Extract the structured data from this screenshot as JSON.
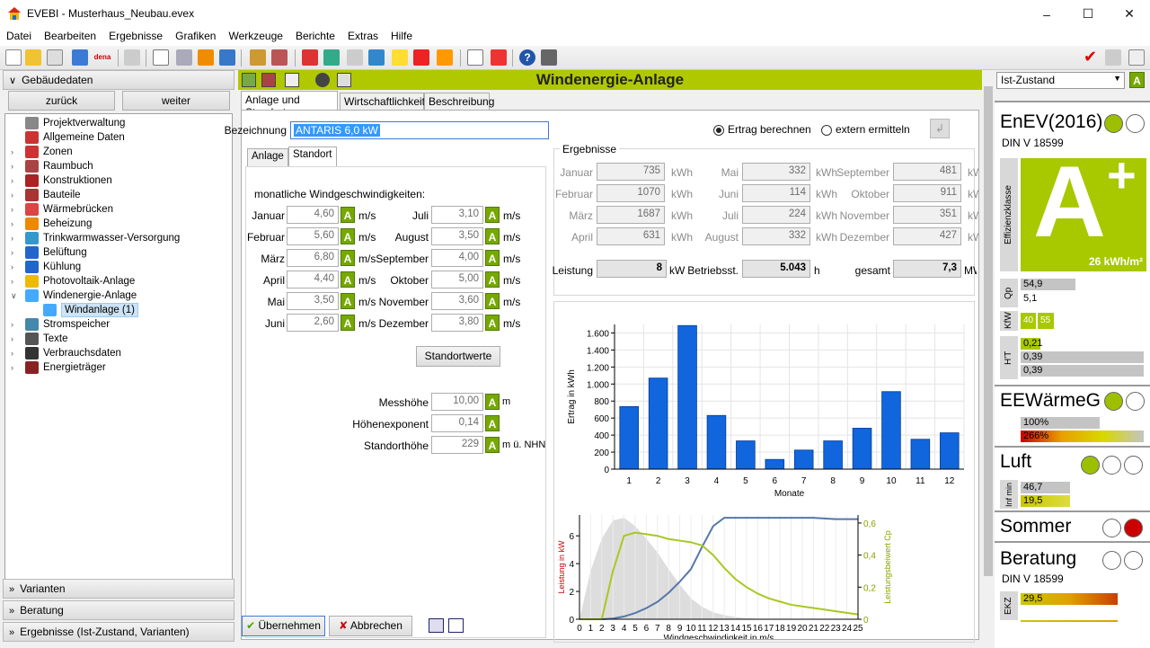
{
  "window": {
    "title": "EVEBI - Musterhaus_Neubau.evex"
  },
  "menu": [
    "Datei",
    "Bearbeiten",
    "Ergebnisse",
    "Grafiken",
    "Werkzeuge",
    "Berichte",
    "Extras",
    "Hilfe"
  ],
  "toolbar": {
    "dena_label": "dena"
  },
  "left": {
    "header": "Gebäudedaten",
    "back_label": "zurück",
    "next_label": "weiter",
    "tree": [
      {
        "label": "Projektverwaltung",
        "icon": "gear-icon"
      },
      {
        "label": "Allgemeine Daten",
        "icon": "house-icon"
      },
      {
        "label": "Zonen",
        "icon": "house-icon"
      },
      {
        "label": "Raumbuch",
        "icon": "book-icon"
      },
      {
        "label": "Konstruktionen",
        "icon": "wall-icon"
      },
      {
        "label": "Bauteile",
        "icon": "wall-icon"
      },
      {
        "label": "Wärmebrücken",
        "icon": "bridge-icon"
      },
      {
        "label": "Beheizung",
        "icon": "heater-icon"
      },
      {
        "label": "Trinkwarmwasser-Versorgung",
        "icon": "drop-icon"
      },
      {
        "label": "Belüftung",
        "icon": "fan-icon"
      },
      {
        "label": "Kühlung",
        "icon": "snowflake-icon"
      },
      {
        "label": "Photovoltaik-Anlage",
        "icon": "solar-icon"
      },
      {
        "label": "Windenergie-Anlage",
        "icon": "wind-turbine-icon"
      },
      {
        "label": "Windanlage (1)",
        "icon": "wind-turbine-icon"
      },
      {
        "label": "Stromspeicher",
        "icon": "battery-icon"
      },
      {
        "label": "Texte",
        "icon": "text-icon"
      },
      {
        "label": "Verbrauchsdaten",
        "icon": "meter-icon"
      },
      {
        "label": "Energieträger",
        "icon": "fuel-icon"
      }
    ],
    "sections": [
      "Varianten",
      "Beratung",
      "Ergebnisse (Ist-Zustand, Varianten)"
    ]
  },
  "center": {
    "title": "Windenergie-Anlage",
    "tabs": [
      "Anlage und Standort",
      "Wirtschaftlichkeit",
      "Beschreibung"
    ],
    "designation_label": "Bezeichnung",
    "designation_value": "ANTARIS 6,0 kW",
    "radio_calc": "Ertrag berechnen",
    "radio_ext": "extern ermitteln",
    "subtabs": [
      "Anlage",
      "Standort"
    ],
    "wind_title": "monatliche Windgeschwindigkeiten:",
    "unit_ms": "m/s",
    "wind_left": [
      {
        "month": "Januar",
        "value": "4,60"
      },
      {
        "month": "Februar",
        "value": "5,60"
      },
      {
        "month": "März",
        "value": "6,80"
      },
      {
        "month": "April",
        "value": "4,40"
      },
      {
        "month": "Mai",
        "value": "3,50"
      },
      {
        "month": "Juni",
        "value": "2,60"
      }
    ],
    "wind_right": [
      {
        "month": "Juli",
        "value": "3,10"
      },
      {
        "month": "August",
        "value": "3,50"
      },
      {
        "month": "September",
        "value": "4,00"
      },
      {
        "month": "Oktober",
        "value": "5,00"
      },
      {
        "month": "November",
        "value": "3,60"
      },
      {
        "month": "Dezember",
        "value": "3,80"
      }
    ],
    "standort_btn": "Standortwerte",
    "a_label": "A",
    "site": [
      {
        "label": "Messhöhe",
        "value": "10,00",
        "unit": "m"
      },
      {
        "label": "Höhenexponent",
        "value": "0,14",
        "unit": ""
      },
      {
        "label": "Standorthöhe",
        "value": "229",
        "unit": "m ü. NHN"
      }
    ],
    "results_title": "Ergebnisse",
    "unit_kwh": "kWh",
    "results": [
      [
        {
          "month": "Januar",
          "value": "735"
        },
        {
          "month": "Mai",
          "value": "332"
        },
        {
          "month": "September",
          "value": "481"
        }
      ],
      [
        {
          "month": "Februar",
          "value": "1070"
        },
        {
          "month": "Juni",
          "value": "114"
        },
        {
          "month": "Oktober",
          "value": "911"
        }
      ],
      [
        {
          "month": "März",
          "value": "1687"
        },
        {
          "month": "Juli",
          "value": "224"
        },
        {
          "month": "November",
          "value": "351"
        }
      ],
      [
        {
          "month": "April",
          "value": "631"
        },
        {
          "month": "August",
          "value": "332"
        },
        {
          "month": "Dezember",
          "value": "427"
        }
      ]
    ],
    "leistung_label": "Leistung",
    "leistung_value": "8",
    "leistung_unit": "kW",
    "betrieb_label": "Betriebsst.",
    "betrieb_value": "5.043",
    "betrieb_unit": "h",
    "gesamt_label": "gesamt",
    "gesamt_value": "7,3",
    "gesamt_unit": "MWh",
    "ok_btn": "Übernehmen",
    "cancel_btn": "Abbrechen"
  },
  "chart_data": [
    {
      "type": "bar",
      "categories": [
        "1",
        "2",
        "3",
        "4",
        "5",
        "6",
        "7",
        "8",
        "9",
        "10",
        "11",
        "12"
      ],
      "values": [
        735,
        1070,
        1687,
        631,
        332,
        114,
        224,
        332,
        481,
        911,
        351,
        427
      ],
      "xlabel": "Monate",
      "ylabel": "Ertrag in kWh",
      "ylim": [
        0,
        1700
      ],
      "yticks": [
        "0",
        "200",
        "400",
        "600",
        "800",
        "1.000",
        "1.200",
        "1.400",
        "1.600"
      ],
      "color": "#1166dd"
    },
    {
      "type": "line",
      "x": [
        0,
        1,
        2,
        3,
        4,
        5,
        6,
        7,
        8,
        9,
        10,
        11,
        12,
        13,
        14,
        15,
        16,
        17,
        18,
        19,
        20,
        21,
        22,
        23,
        24,
        25
      ],
      "xlabel": "Windgeschwindigkeit in m/s",
      "ylabel": "Leistung in kW",
      "ylabel2": "Leistungsbeiwert Cp",
      "ylim": [
        0,
        7.5
      ],
      "ylim2": [
        0,
        0.65
      ],
      "yticks": [
        "0",
        "2",
        "4",
        "6"
      ],
      "yticks2": [
        "0",
        "0,2",
        "0,4",
        "0,6"
      ],
      "series": [
        {
          "axis": "left",
          "color": "#5577aa",
          "values": [
            0,
            0,
            0,
            0.05,
            0.2,
            0.45,
            0.8,
            1.25,
            1.9,
            2.7,
            3.6,
            5.2,
            6.7,
            7.3,
            7.3,
            7.3,
            7.3,
            7.3,
            7.3,
            7.3,
            7.3,
            7.3,
            7.25,
            7.2,
            7.2,
            7.2
          ]
        },
        {
          "axis": "right",
          "color": "#a8c822",
          "values": [
            0,
            0,
            0,
            0.3,
            0.52,
            0.54,
            0.53,
            0.52,
            0.5,
            0.49,
            0.48,
            0.46,
            0.4,
            0.32,
            0.25,
            0.2,
            0.16,
            0.13,
            0.11,
            0.09,
            0.08,
            0.07,
            0.06,
            0.05,
            0.04,
            0.03
          ]
        },
        {
          "axis": "area",
          "color": "#dddddd",
          "values": [
            0,
            3.5,
            5.8,
            7.1,
            7.3,
            6.7,
            5.8,
            4.8,
            3.6,
            2.5,
            1.5,
            0.9,
            0.5,
            0.3,
            0.15,
            0.08,
            0.04,
            0.02,
            0.01,
            0,
            0,
            0,
            0,
            0,
            0,
            0
          ]
        }
      ]
    }
  ],
  "right": {
    "dropdown": "Ist-Zustand",
    "enev_title": "EnEV(2016)",
    "enev_sub": "DIN V 18599",
    "efficiency_label": "Effizienzklasse",
    "efficiency_class": "A",
    "efficiency_plus": "+",
    "efficiency_value": "26 kWh/m²",
    "qp_label": "Qp",
    "qp_values": [
      "54,9",
      "5,1"
    ],
    "kfw_label": "KfW",
    "kfw_values": [
      "40",
      "55"
    ],
    "ht_label": "H'T",
    "ht_values": [
      "0,21",
      "0,39",
      "0,39"
    ],
    "eew_title": "EEWärmeG",
    "eew_values": [
      "100%",
      "266%"
    ],
    "luft_title": "Luft",
    "luft_label": "Inf min",
    "luft_values": [
      "46,7",
      "19,5"
    ],
    "sommer_title": "Sommer",
    "beratung_title": "Beratung",
    "beratung_sub": "DIN V 18599",
    "ekz_label": "EKZ",
    "ekz_value": "29,5",
    "colors": {
      "green": "#9cc000",
      "red": "#cc0000",
      "accent": "#b0c800"
    }
  }
}
